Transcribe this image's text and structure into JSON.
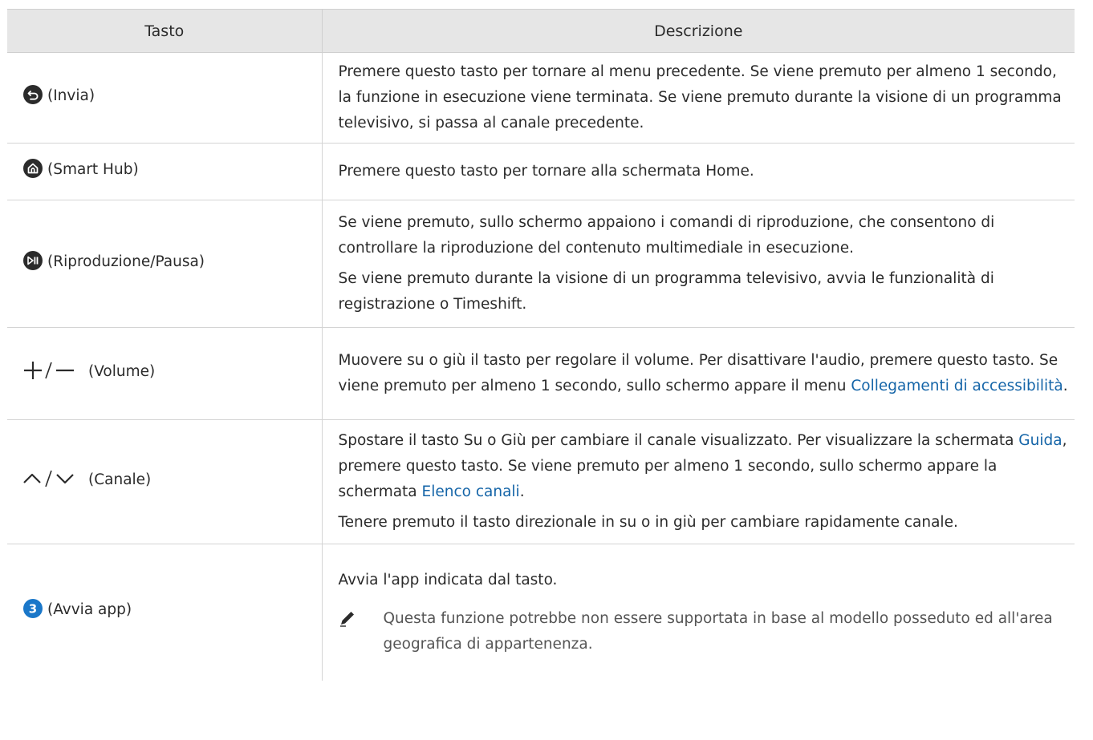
{
  "header": {
    "col_key": "Tasto",
    "col_desc": "Descrizione"
  },
  "rows": [
    {
      "key_icon": "return-icon",
      "key_label": "(Invia)",
      "desc": "Premere questo tasto per tornare al menu precedente. Se viene premuto per almeno 1 secondo, la funzione in esecuzione viene terminata. Se viene premuto durante la visione di un programma televisivo, si passa al canale precedente."
    },
    {
      "key_icon": "home-icon",
      "key_label": "(Smart Hub)",
      "desc": "Premere questo tasto per tornare alla schermata Home."
    },
    {
      "key_icon": "play-pause-icon",
      "key_label": "(Riproduzione/Pausa)",
      "desc1": "Se viene premuto, sullo schermo appaiono i comandi di riproduzione, che consentono di controllare la riproduzione del contenuto multimediale in esecuzione.",
      "desc2": "Se viene premuto durante la visione di un programma televisivo, avvia le funzionalità di registrazione o Timeshift."
    },
    {
      "key_icon": "volume-plus-minus-icon",
      "key_label": "(Volume)",
      "desc_a": "Muovere su o giù il tasto per regolare il volume. Per disattivare l'audio, premere questo tasto. Se viene premuto per almeno 1 secondo, sullo schermo appare il menu ",
      "desc_link": "Collegamenti di accessibilità",
      "desc_b": "."
    },
    {
      "key_icon": "channel-up-down-icon",
      "key_label": "(Canale)",
      "desc1_a": "Spostare il tasto Su o Giù per cambiare il canale visualizzato. Per visualizzare la schermata ",
      "desc1_link1": "Guida",
      "desc1_b": ", premere questo tasto. Se viene premuto per almeno 1 secondo, sullo schermo appare la schermata ",
      "desc1_link2": "Elenco canali",
      "desc1_c": ".",
      "desc2": "Tenere premuto il tasto direzionale in su o in giù per cambiare rapidamente canale."
    },
    {
      "key_icon": "number-3-icon",
      "key_label": "(Avvia app)",
      "desc": "Avvia l'app indicata dal tasto.",
      "note_icon": "pencil-note-icon",
      "note": "Questa funzione potrebbe non essere supportata in base al modello posseduto ed all'area geografica di appartenenza."
    }
  ],
  "colors": {
    "header_bg": "#e6e6e6",
    "link": "#1565a8",
    "icon": "#2b2b2b",
    "icon_3": "#1a77c9"
  }
}
